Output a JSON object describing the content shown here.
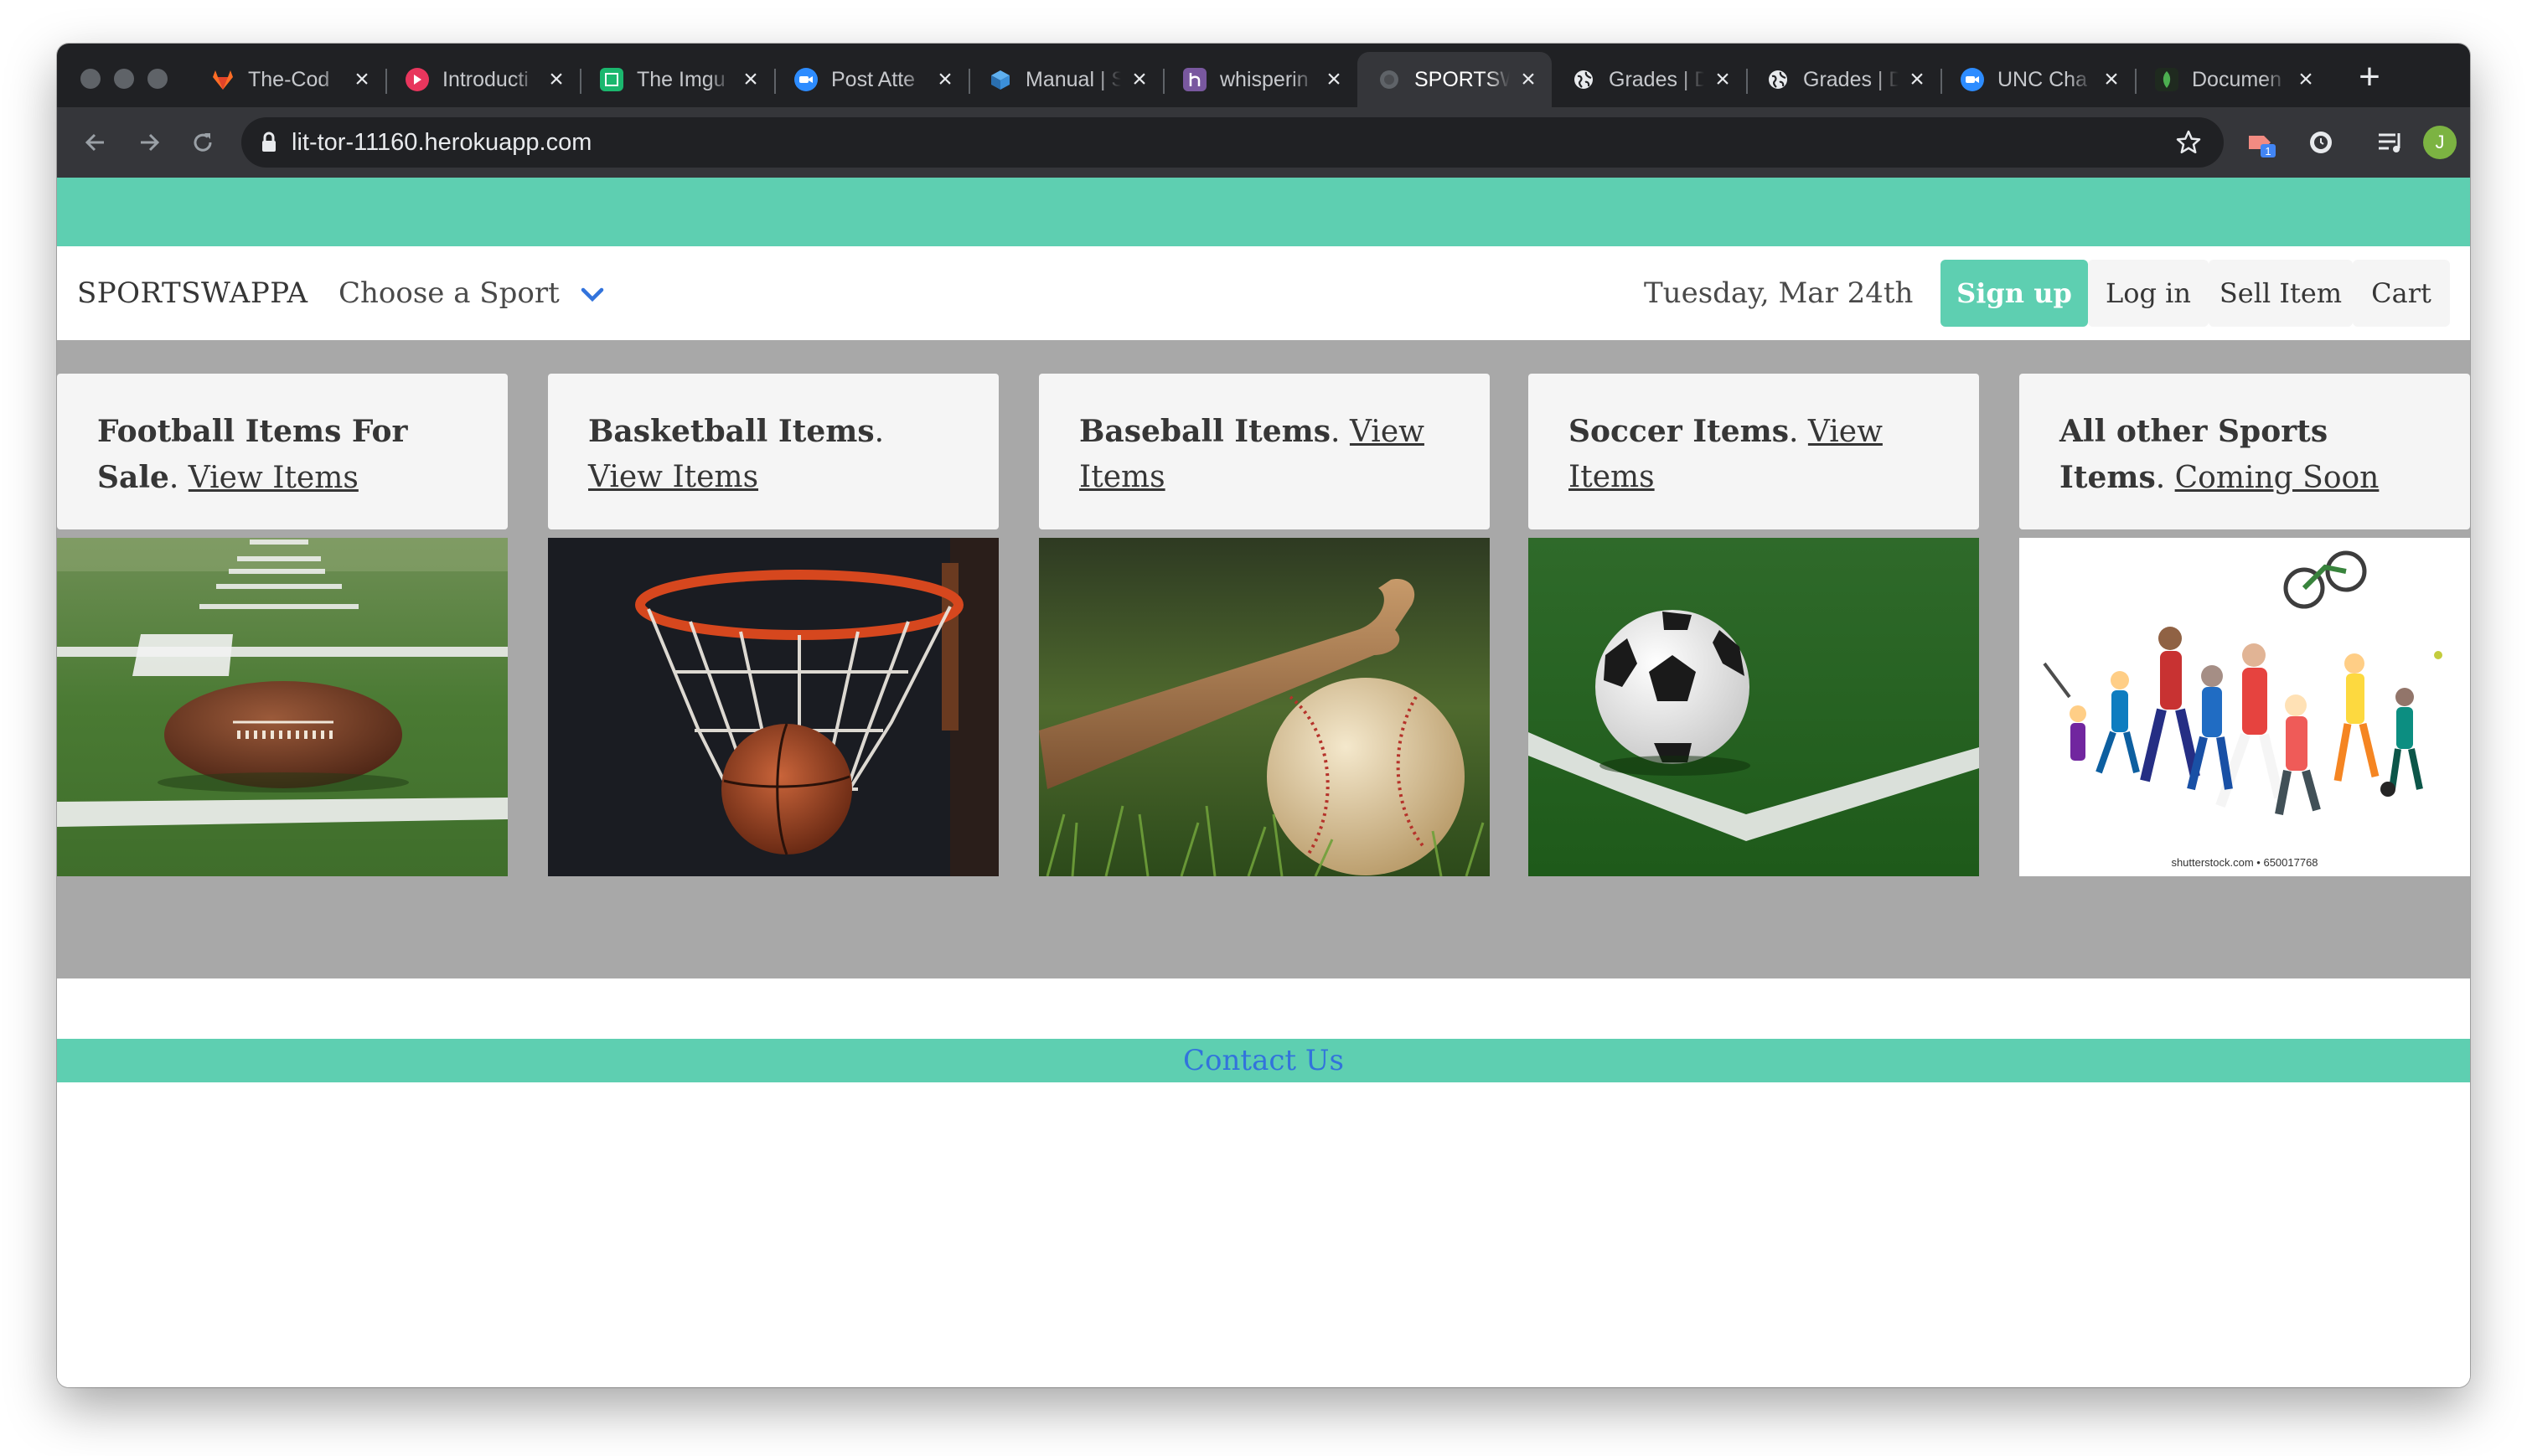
{
  "browser": {
    "tabs": [
      {
        "title": "The-Cod",
        "icon": "gitlab-icon",
        "color": "#fc6d26"
      },
      {
        "title": "Introducti",
        "icon": "play-icon",
        "color": "#e8365d"
      },
      {
        "title": "The Imgu",
        "icon": "imgur-icon",
        "color": "#1bb76e"
      },
      {
        "title": "Post Atte",
        "icon": "zoom-icon",
        "color": "#2d8cff"
      },
      {
        "title": "Manual | S",
        "icon": "cube-icon",
        "color": "#3b8fd9"
      },
      {
        "title": "whisperin",
        "icon": "heroku-icon",
        "color": "#79589f"
      },
      {
        "title": "SPORTSW",
        "icon": "globe-icon",
        "color": "#5f6368"
      },
      {
        "title": "Grades | D",
        "icon": "globe-icon",
        "color": "#ffffff"
      },
      {
        "title": "Grades | D",
        "icon": "globe-icon",
        "color": "#ffffff"
      },
      {
        "title": "UNC Cha",
        "icon": "zoom-icon",
        "color": "#2d8cff"
      },
      {
        "title": "Documen",
        "icon": "leaf-icon",
        "color": "#4caf50"
      }
    ],
    "active_tab": 6,
    "url": "lit-tor-11160.herokuapp.com",
    "extension_badge": "1",
    "profile_initial": "J"
  },
  "nav": {
    "brand": "SPORTSWAPPA",
    "sport_dropdown": "Choose a Sport",
    "date": "Tuesday, Mar 24th",
    "signup": "Sign up",
    "login": "Log in",
    "sell": "Sell Item",
    "cart": "Cart"
  },
  "cards": [
    {
      "bold": "Football Items For Sale",
      "link": "View Items",
      "image": "football-on-field-image"
    },
    {
      "bold": "Basketball Items",
      "link": "View Items",
      "image": "basketball-hoop-image"
    },
    {
      "bold": "Baseball Items",
      "link": "View Items",
      "image": "baseball-and-bat-image"
    },
    {
      "bold": "Soccer Items",
      "link": "View Items",
      "image": "soccer-ball-image"
    },
    {
      "bold": "All other Sports Items",
      "link": "Coming Soon",
      "image": "sports-collage-image"
    }
  ],
  "watermark": "shutterstock.com • 650017768",
  "footer": {
    "contact": "Contact Us"
  },
  "colors": {
    "accent": "#5ecfb1",
    "link": "#3273dc",
    "content_bg": "#a8a8a8"
  }
}
